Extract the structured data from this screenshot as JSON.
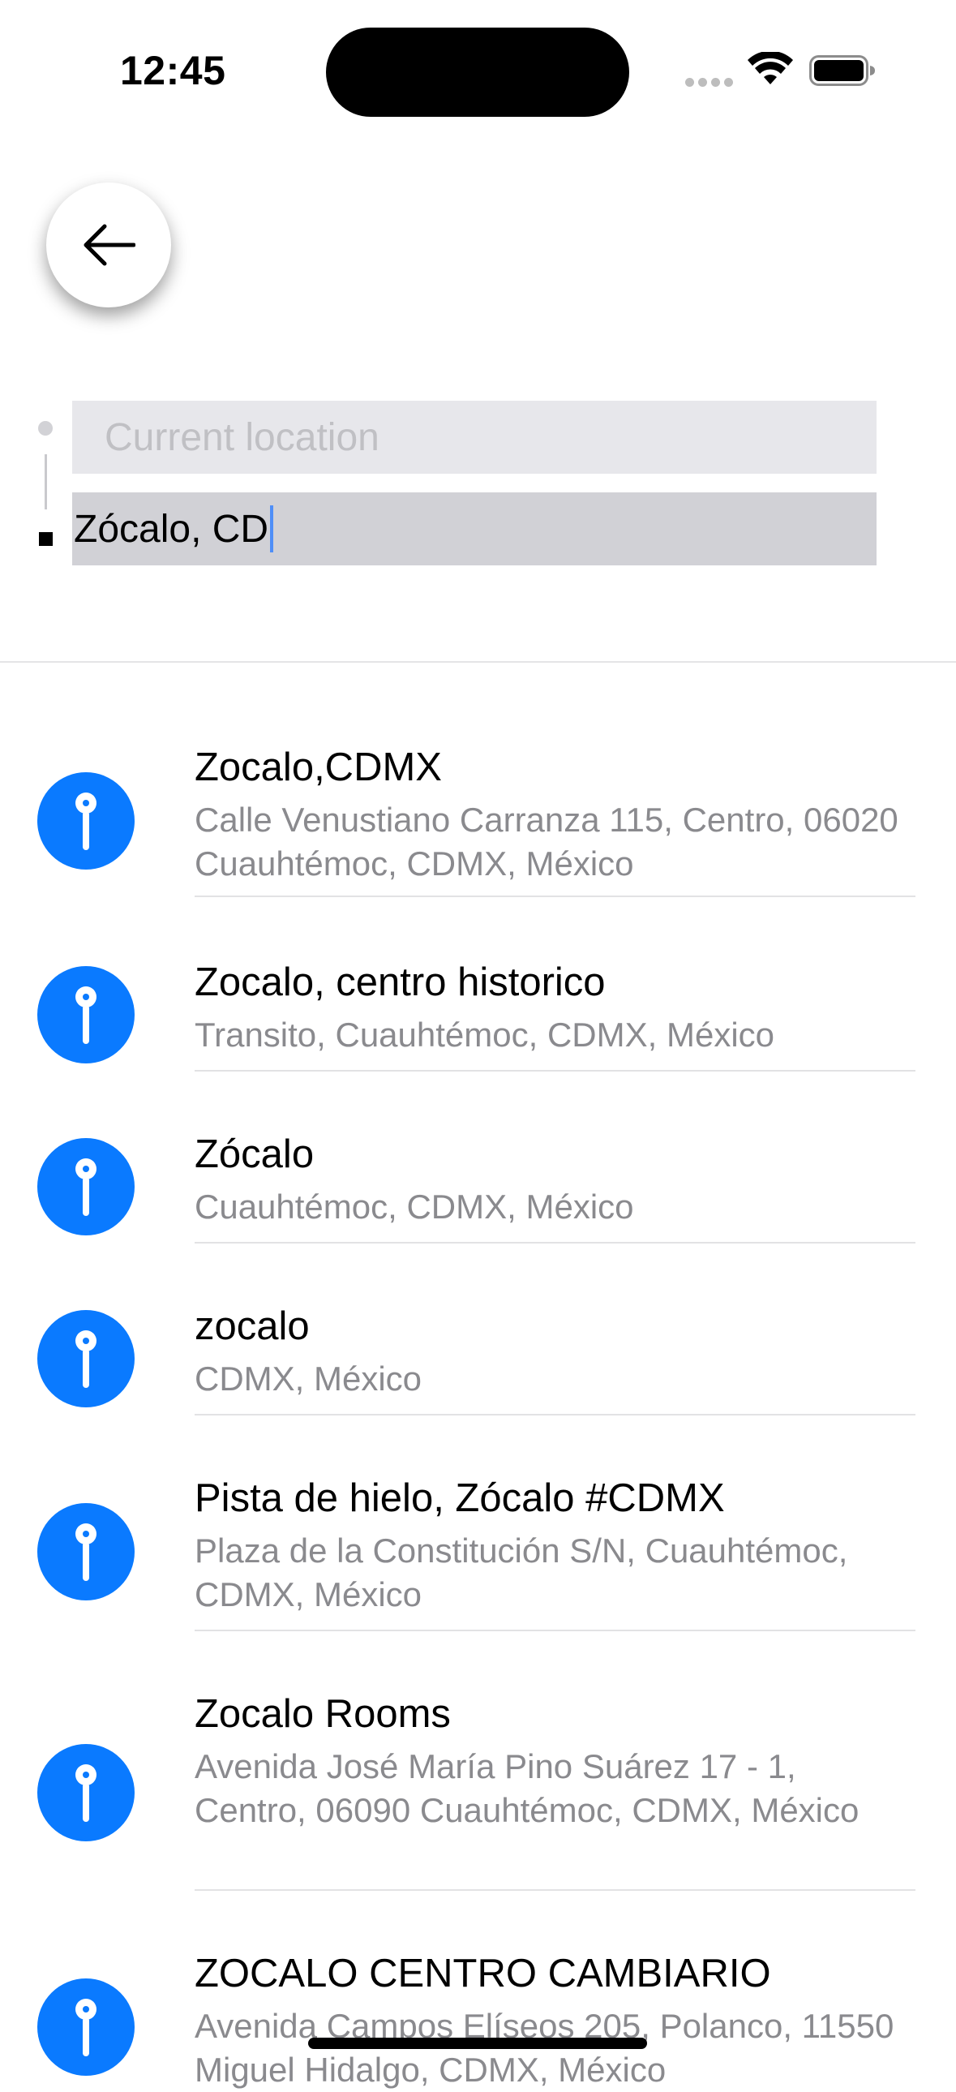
{
  "status_bar": {
    "time": "12:45"
  },
  "route": {
    "origin_placeholder": "Current location",
    "destination_value": "Zócalo, CD"
  },
  "results": [
    {
      "title": "Zocalo,CDMX",
      "subtitle": "Calle Venustiano Carranza 115, Centro, 06020 Cuauhtémoc, CDMX, México"
    },
    {
      "title": "Zocalo, centro historico",
      "subtitle": "Transito, Cuauhtémoc, CDMX, México"
    },
    {
      "title": "Zócalo",
      "subtitle": "Cuauhtémoc, CDMX, México"
    },
    {
      "title": "zocalo",
      "subtitle": "CDMX, México"
    },
    {
      "title": "Pista de hielo, Zócalo #CDMX",
      "subtitle": "Plaza de la Constitución S/N, Cuauhtémoc, CDMX, México"
    },
    {
      "title": "Zocalo Rooms",
      "subtitle": "Avenida José María Pino Suárez 17 - 1, Centro, 06090 Cuauhtémoc, CDMX, México"
    },
    {
      "title": "ZOCALO CENTRO CAMBIARIO",
      "subtitle": "Avenida Campos Elíseos 205, Polanco, 11550 Miguel Hidalgo, CDMX, México"
    }
  ],
  "icons": {
    "back": "arrow-left-icon",
    "result": "map-pin-icon",
    "wifi": "wifi-icon",
    "battery": "battery-icon"
  },
  "colors": {
    "accent": "#0a7aff",
    "caret": "#4f8ef7"
  }
}
